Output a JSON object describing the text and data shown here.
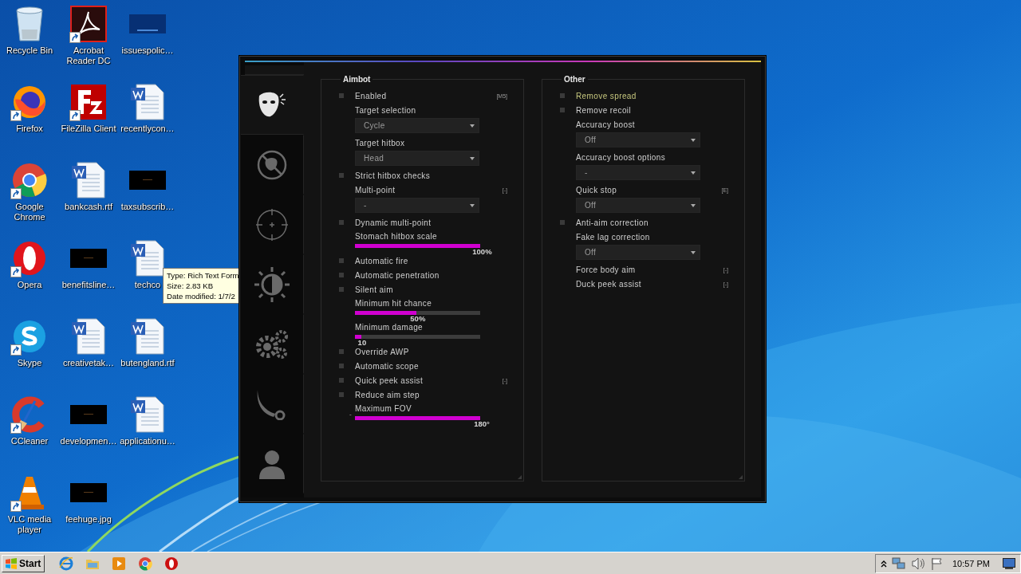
{
  "desktop": {
    "icons": [
      {
        "label": "Recycle Bin",
        "kind": "recycle",
        "shortcut": false
      },
      {
        "label": "Firefox",
        "kind": "firefox",
        "shortcut": true
      },
      {
        "label": "Google Chrome",
        "kind": "chrome",
        "shortcut": true
      },
      {
        "label": "Opera",
        "kind": "opera",
        "shortcut": true
      },
      {
        "label": "Skype",
        "kind": "skype",
        "shortcut": true
      },
      {
        "label": "CCleaner",
        "kind": "ccleaner",
        "shortcut": true
      },
      {
        "label": "VLC media player",
        "kind": "vlc",
        "shortcut": true
      },
      {
        "label": "Acrobat Reader DC",
        "kind": "acrobat",
        "shortcut": true
      },
      {
        "label": "FileZilla Client",
        "kind": "filezilla",
        "shortcut": true
      },
      {
        "label": "bankcash.rtf",
        "kind": "document",
        "shortcut": false
      },
      {
        "label": "benefitsline…",
        "shortcut": false
      },
      {
        "label": "creativetak…",
        "kind": "document",
        "shortcut": false
      },
      {
        "label": "developmen…",
        "shortcut": false
      },
      {
        "label": "feehuge.jpg",
        "shortcut": false
      },
      {
        "label": "issuespolic…",
        "kind": "banner",
        "shortcut": false
      },
      {
        "label": "recentlycon…",
        "kind": "document",
        "shortcut": false
      },
      {
        "label": "taxsubscrib…",
        "shortcut": false
      },
      {
        "label": "techco",
        "kind": "document",
        "shortcut": false
      },
      {
        "label": "butengland.rtf",
        "kind": "document",
        "shortcut": false
      },
      {
        "label": "applicationu…",
        "kind": "document",
        "shortcut": false
      }
    ],
    "tooltip": {
      "lines": [
        "Type: Rich Text Form",
        "Size: 2.83 KB",
        "Date modified: 1/7/2"
      ]
    }
  },
  "menu": {
    "tabs": [
      {
        "kind": "mask",
        "selected": true
      },
      {
        "kind": "noaim",
        "selected": false
      },
      {
        "kind": "crosshair",
        "selected": false
      },
      {
        "kind": "contrast",
        "selected": false
      },
      {
        "kind": "gears",
        "selected": false
      },
      {
        "kind": "knife",
        "selected": false
      },
      {
        "kind": "user",
        "selected": false
      }
    ],
    "groups": [
      {
        "title": "Aimbot",
        "items": [
          {
            "kind": "checkbox",
            "label": "Enabled",
            "checked": false,
            "highlighted": false,
            "hotkey": "[M5]"
          },
          {
            "kind": "dropdown",
            "label": "Target selection",
            "value": "Cycle"
          },
          {
            "kind": "dropdown",
            "label": "Target hitbox",
            "value": "Head"
          },
          {
            "kind": "checkbox",
            "label": "Strict hitbox checks",
            "checked": false,
            "highlighted": false
          },
          {
            "kind": "dropdown",
            "label": "Multi-point",
            "value": "-",
            "hotkey": "[-]"
          },
          {
            "kind": "checkbox",
            "label": "Dynamic multi-point",
            "checked": false,
            "highlighted": false
          },
          {
            "kind": "slider",
            "label": "Stomach hitbox scale",
            "level": 1,
            "reading": "100%"
          },
          {
            "kind": "checkbox",
            "label": "Automatic fire",
            "checked": false,
            "highlighted": false
          },
          {
            "kind": "checkbox",
            "label": "Automatic penetration",
            "checked": false,
            "highlighted": false
          },
          {
            "kind": "checkbox",
            "label": "Silent aim",
            "checked": false,
            "highlighted": false
          },
          {
            "kind": "slider",
            "label": "Minimum hit chance",
            "level": 0.49,
            "reading": "50%"
          },
          {
            "kind": "slider",
            "label": "Minimum damage",
            "level": 0.05,
            "reading": "10"
          },
          {
            "kind": "checkbox",
            "label": "Override AWP",
            "checked": false,
            "highlighted": false
          },
          {
            "kind": "checkbox",
            "label": "Automatic scope",
            "checked": false,
            "highlighted": false
          },
          {
            "kind": "checkbox",
            "label": "Quick peek assist",
            "checked": false,
            "highlighted": false,
            "hotkey": "[-]"
          },
          {
            "kind": "checkbox",
            "label": "Reduce aim step",
            "checked": false,
            "highlighted": false
          },
          {
            "kind": "slider",
            "label": "Maximum FOV",
            "level": 1,
            "reading": "180°",
            "prefix": "-"
          }
        ]
      },
      {
        "title": "Other",
        "items": [
          {
            "kind": "checkbox",
            "label": "Remove spread",
            "checked": false,
            "highlighted": true
          },
          {
            "kind": "checkbox",
            "label": "Remove recoil",
            "checked": false,
            "highlighted": false
          },
          {
            "kind": "dropdown",
            "label": "Accuracy boost",
            "value": "Off"
          },
          {
            "kind": "dropdown",
            "label": "Accuracy boost options",
            "value": "-"
          },
          {
            "kind": "dropdown",
            "label": "Quick stop",
            "value": "Off",
            "hotkey": "[E]"
          },
          {
            "kind": "checkbox",
            "label": "Anti-aim correction",
            "checked": false,
            "highlighted": false
          },
          {
            "kind": "dropdown",
            "label": "Fake lag correction",
            "value": "Off"
          },
          {
            "kind": "text",
            "label": "Force body aim",
            "hotkey": "[-]"
          },
          {
            "kind": "text",
            "label": "Duck peek assist",
            "hotkey": "[-]"
          }
        ]
      }
    ]
  },
  "taskbar": {
    "start": "Start",
    "apps": [
      {
        "kind": "ie"
      },
      {
        "kind": "folder"
      },
      {
        "kind": "player"
      },
      {
        "kind": "chrome"
      },
      {
        "kind": "opera"
      }
    ],
    "tray": [
      {
        "kind": "chevron"
      },
      {
        "kind": "network"
      },
      {
        "kind": "speaker"
      },
      {
        "kind": "flag"
      }
    ],
    "clock": "10:57 PM"
  }
}
